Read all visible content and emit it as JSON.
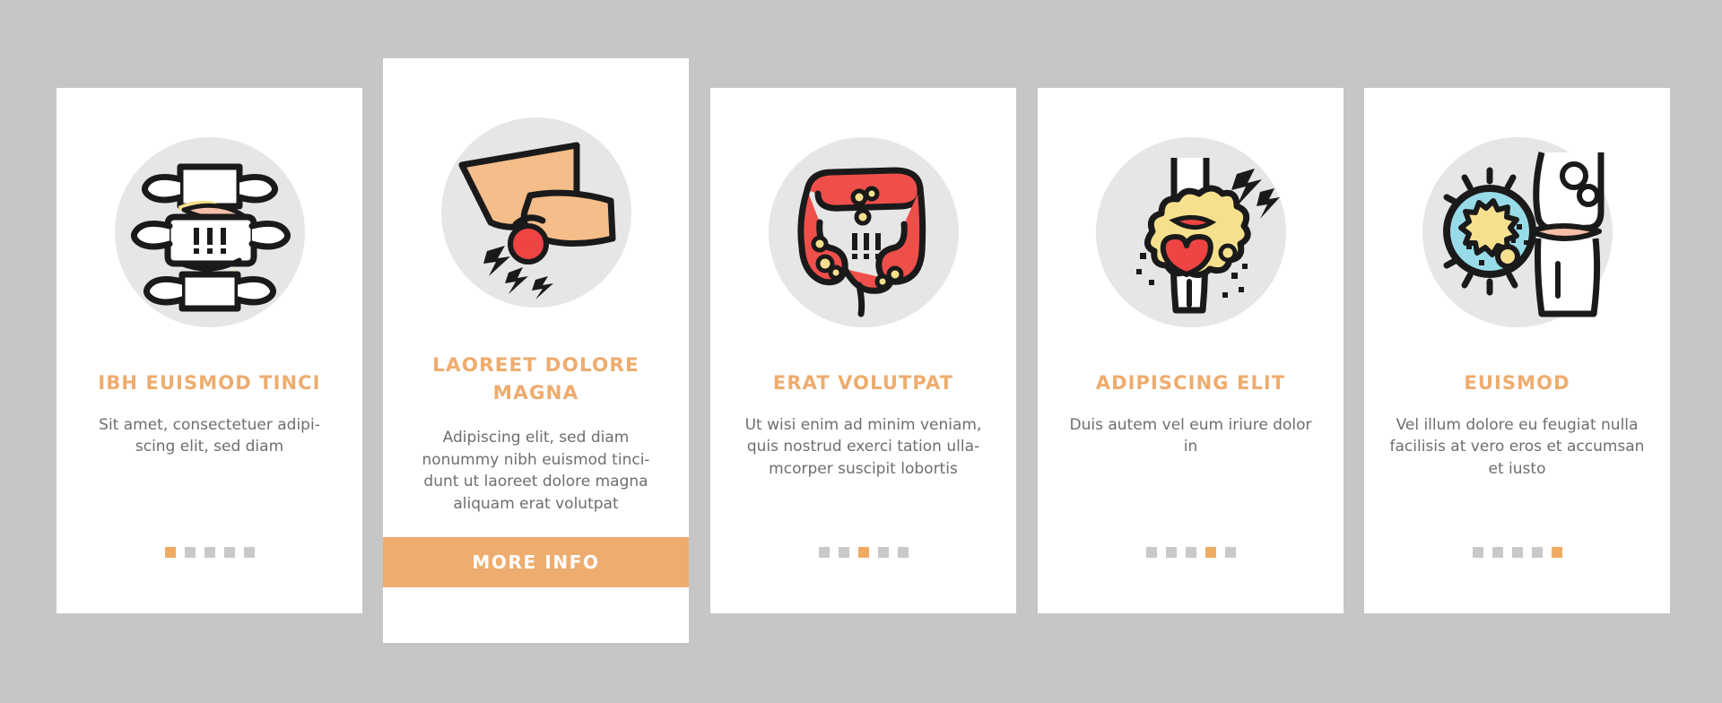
{
  "page": {
    "background_color": "#c6c6c6",
    "card_background": "#ffffff",
    "accent_color": "#eeac6e",
    "title_color": "#eeac6e",
    "body_text_color": "#6e6e6e",
    "dot_inactive_color": "#c9c9c9",
    "dot_active_color": "#f0ab63",
    "illustration_circle_color": "#e6e6e6"
  },
  "cards": [
    {
      "id": "card-1",
      "featured": false,
      "icon_name": "spine-vertebrae-icon",
      "title": "IBH EUISMOD TINCI",
      "description": "Sit amet, consectetuer adipi-scing elit, sed diam",
      "dots": {
        "count": 5,
        "active_index": 0
      }
    },
    {
      "id": "card-2",
      "featured": true,
      "icon_name": "elbow-pain-icon",
      "title": "LAOREET DOLORE MAGNA",
      "description": "Adipiscing elit, sed diam nonummy nibh euismod tinci-dunt ut laoreet dolore magna aliquam erat volutpat",
      "button_label": "MORE INFO",
      "dots": {
        "count": 0,
        "active_index": -1
      }
    },
    {
      "id": "card-3",
      "featured": false,
      "icon_name": "intestine-colon-icon",
      "title": "ERAT VOLUTPAT",
      "description": "Ut wisi enim ad minim veniam, quis nostrud exerci tation ulla-mcorper suscipit lobortis",
      "dots": {
        "count": 5,
        "active_index": 2
      }
    },
    {
      "id": "card-4",
      "featured": false,
      "icon_name": "knee-joint-inflammation-icon",
      "title": "ADIPISCING ELIT",
      "description": "Duis autem vel eum iriure dolor in",
      "dots": {
        "count": 5,
        "active_index": 3
      }
    },
    {
      "id": "card-5",
      "featured": false,
      "icon_name": "joint-bacteria-magnifier-icon",
      "title": "EUISMOD",
      "description": "Vel illum dolore eu feugiat nulla facilisis at vero eros et accumsan et iusto",
      "dots": {
        "count": 5,
        "active_index": 4
      }
    }
  ]
}
